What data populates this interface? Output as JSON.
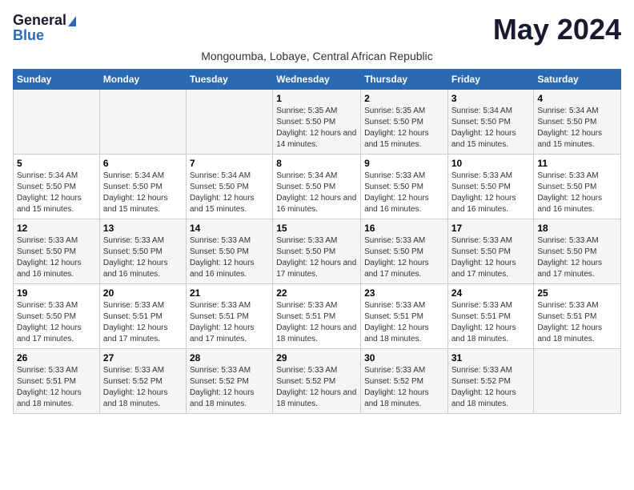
{
  "logo": {
    "general": "General",
    "blue": "Blue"
  },
  "header": {
    "month": "May 2024",
    "subtitle": "Mongoumba, Lobaye, Central African Republic"
  },
  "weekdays": [
    "Sunday",
    "Monday",
    "Tuesday",
    "Wednesday",
    "Thursday",
    "Friday",
    "Saturday"
  ],
  "weeks": [
    [
      {
        "day": "",
        "sunrise": "",
        "sunset": "",
        "daylight": ""
      },
      {
        "day": "",
        "sunrise": "",
        "sunset": "",
        "daylight": ""
      },
      {
        "day": "",
        "sunrise": "",
        "sunset": "",
        "daylight": ""
      },
      {
        "day": "1",
        "sunrise": "Sunrise: 5:35 AM",
        "sunset": "Sunset: 5:50 PM",
        "daylight": "Daylight: 12 hours and 14 minutes."
      },
      {
        "day": "2",
        "sunrise": "Sunrise: 5:35 AM",
        "sunset": "Sunset: 5:50 PM",
        "daylight": "Daylight: 12 hours and 15 minutes."
      },
      {
        "day": "3",
        "sunrise": "Sunrise: 5:34 AM",
        "sunset": "Sunset: 5:50 PM",
        "daylight": "Daylight: 12 hours and 15 minutes."
      },
      {
        "day": "4",
        "sunrise": "Sunrise: 5:34 AM",
        "sunset": "Sunset: 5:50 PM",
        "daylight": "Daylight: 12 hours and 15 minutes."
      }
    ],
    [
      {
        "day": "5",
        "sunrise": "Sunrise: 5:34 AM",
        "sunset": "Sunset: 5:50 PM",
        "daylight": "Daylight: 12 hours and 15 minutes."
      },
      {
        "day": "6",
        "sunrise": "Sunrise: 5:34 AM",
        "sunset": "Sunset: 5:50 PM",
        "daylight": "Daylight: 12 hours and 15 minutes."
      },
      {
        "day": "7",
        "sunrise": "Sunrise: 5:34 AM",
        "sunset": "Sunset: 5:50 PM",
        "daylight": "Daylight: 12 hours and 15 minutes."
      },
      {
        "day": "8",
        "sunrise": "Sunrise: 5:34 AM",
        "sunset": "Sunset: 5:50 PM",
        "daylight": "Daylight: 12 hours and 16 minutes."
      },
      {
        "day": "9",
        "sunrise": "Sunrise: 5:33 AM",
        "sunset": "Sunset: 5:50 PM",
        "daylight": "Daylight: 12 hours and 16 minutes."
      },
      {
        "day": "10",
        "sunrise": "Sunrise: 5:33 AM",
        "sunset": "Sunset: 5:50 PM",
        "daylight": "Daylight: 12 hours and 16 minutes."
      },
      {
        "day": "11",
        "sunrise": "Sunrise: 5:33 AM",
        "sunset": "Sunset: 5:50 PM",
        "daylight": "Daylight: 12 hours and 16 minutes."
      }
    ],
    [
      {
        "day": "12",
        "sunrise": "Sunrise: 5:33 AM",
        "sunset": "Sunset: 5:50 PM",
        "daylight": "Daylight: 12 hours and 16 minutes."
      },
      {
        "day": "13",
        "sunrise": "Sunrise: 5:33 AM",
        "sunset": "Sunset: 5:50 PM",
        "daylight": "Daylight: 12 hours and 16 minutes."
      },
      {
        "day": "14",
        "sunrise": "Sunrise: 5:33 AM",
        "sunset": "Sunset: 5:50 PM",
        "daylight": "Daylight: 12 hours and 16 minutes."
      },
      {
        "day": "15",
        "sunrise": "Sunrise: 5:33 AM",
        "sunset": "Sunset: 5:50 PM",
        "daylight": "Daylight: 12 hours and 17 minutes."
      },
      {
        "day": "16",
        "sunrise": "Sunrise: 5:33 AM",
        "sunset": "Sunset: 5:50 PM",
        "daylight": "Daylight: 12 hours and 17 minutes."
      },
      {
        "day": "17",
        "sunrise": "Sunrise: 5:33 AM",
        "sunset": "Sunset: 5:50 PM",
        "daylight": "Daylight: 12 hours and 17 minutes."
      },
      {
        "day": "18",
        "sunrise": "Sunrise: 5:33 AM",
        "sunset": "Sunset: 5:50 PM",
        "daylight": "Daylight: 12 hours and 17 minutes."
      }
    ],
    [
      {
        "day": "19",
        "sunrise": "Sunrise: 5:33 AM",
        "sunset": "Sunset: 5:50 PM",
        "daylight": "Daylight: 12 hours and 17 minutes."
      },
      {
        "day": "20",
        "sunrise": "Sunrise: 5:33 AM",
        "sunset": "Sunset: 5:51 PM",
        "daylight": "Daylight: 12 hours and 17 minutes."
      },
      {
        "day": "21",
        "sunrise": "Sunrise: 5:33 AM",
        "sunset": "Sunset: 5:51 PM",
        "daylight": "Daylight: 12 hours and 17 minutes."
      },
      {
        "day": "22",
        "sunrise": "Sunrise: 5:33 AM",
        "sunset": "Sunset: 5:51 PM",
        "daylight": "Daylight: 12 hours and 18 minutes."
      },
      {
        "day": "23",
        "sunrise": "Sunrise: 5:33 AM",
        "sunset": "Sunset: 5:51 PM",
        "daylight": "Daylight: 12 hours and 18 minutes."
      },
      {
        "day": "24",
        "sunrise": "Sunrise: 5:33 AM",
        "sunset": "Sunset: 5:51 PM",
        "daylight": "Daylight: 12 hours and 18 minutes."
      },
      {
        "day": "25",
        "sunrise": "Sunrise: 5:33 AM",
        "sunset": "Sunset: 5:51 PM",
        "daylight": "Daylight: 12 hours and 18 minutes."
      }
    ],
    [
      {
        "day": "26",
        "sunrise": "Sunrise: 5:33 AM",
        "sunset": "Sunset: 5:51 PM",
        "daylight": "Daylight: 12 hours and 18 minutes."
      },
      {
        "day": "27",
        "sunrise": "Sunrise: 5:33 AM",
        "sunset": "Sunset: 5:52 PM",
        "daylight": "Daylight: 12 hours and 18 minutes."
      },
      {
        "day": "28",
        "sunrise": "Sunrise: 5:33 AM",
        "sunset": "Sunset: 5:52 PM",
        "daylight": "Daylight: 12 hours and 18 minutes."
      },
      {
        "day": "29",
        "sunrise": "Sunrise: 5:33 AM",
        "sunset": "Sunset: 5:52 PM",
        "daylight": "Daylight: 12 hours and 18 minutes."
      },
      {
        "day": "30",
        "sunrise": "Sunrise: 5:33 AM",
        "sunset": "Sunset: 5:52 PM",
        "daylight": "Daylight: 12 hours and 18 minutes."
      },
      {
        "day": "31",
        "sunrise": "Sunrise: 5:33 AM",
        "sunset": "Sunset: 5:52 PM",
        "daylight": "Daylight: 12 hours and 18 minutes."
      },
      {
        "day": "",
        "sunrise": "",
        "sunset": "",
        "daylight": ""
      }
    ]
  ]
}
